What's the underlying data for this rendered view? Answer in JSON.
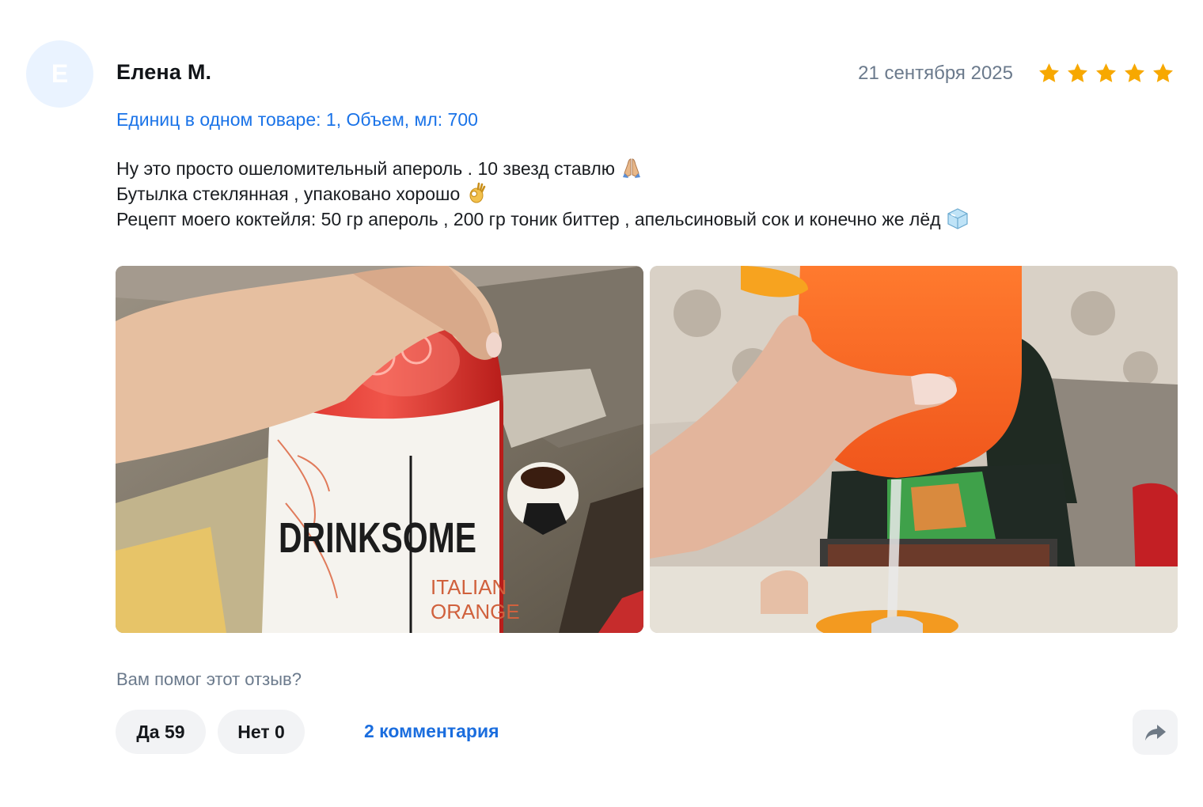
{
  "review": {
    "avatar_letter": "E",
    "author": "Елена М.",
    "date": "21 сентября 2025",
    "rating": 5,
    "star_color": "#f7a800",
    "variant": "Единиц в одном товаре: 1, Объем, мл: 700",
    "text_lines": [
      "Ну это просто ошеломительный апероль . 10 звезд ставлю",
      "Бутылка стеклянная , упаковано хорошо",
      "Рецепт моего коктейля: 50 гр апероль , 200 гр тоник биттер , апельсиновый сок и конечно же лёд"
    ],
    "emojis": [
      "praying-hands-emoji",
      "ok-hand-emoji",
      "ice-cube-emoji"
    ],
    "photos": [
      {
        "label_brand": "DRINKSOME",
        "label_sub_1": "ITALIAN",
        "label_sub_2": "ORANGE"
      },
      {
        "label": ""
      }
    ]
  },
  "footer": {
    "helpful_question": "Вам помог этот отзыв?",
    "yes_label": "Да 59",
    "no_label": "Нет 0",
    "comments_label": "2 комментария",
    "share_icon": "share-arrow-icon"
  }
}
